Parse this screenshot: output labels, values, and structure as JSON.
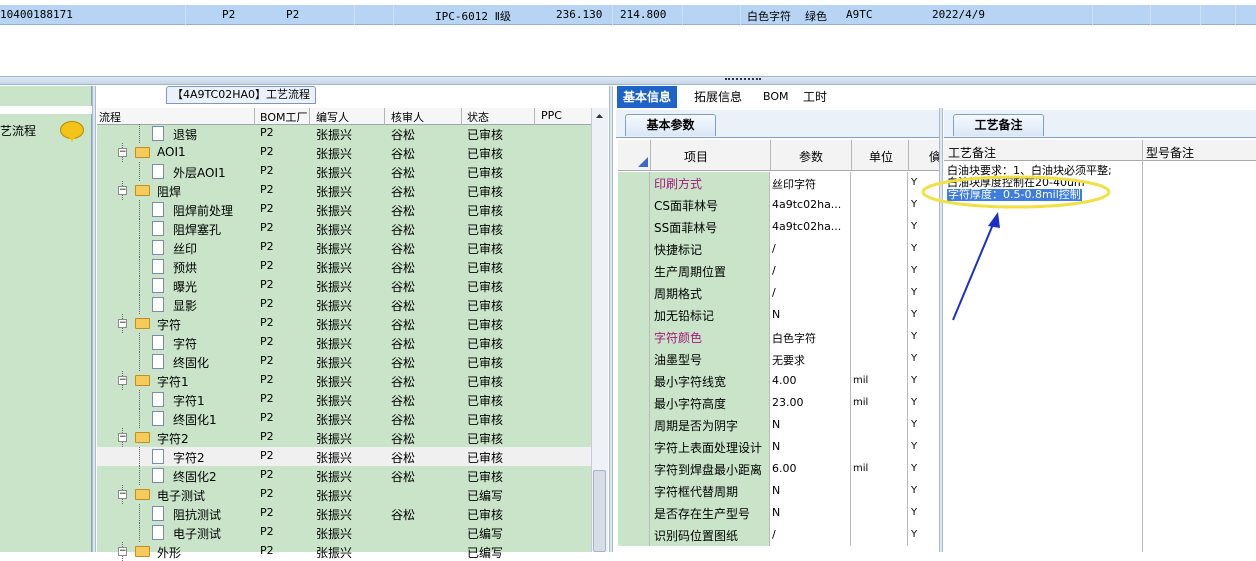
{
  "top_row": {
    "cells": [
      "10400188171",
      "P2",
      "P2",
      "IPC-6012 Ⅱ级",
      "236.130",
      "214.800",
      "白色字符",
      "绿色",
      "A9TC",
      "2022/4/9"
    ]
  },
  "left_panel": {
    "title": "艺流程"
  },
  "tree": {
    "title": "【4A9TC02HA0】工艺流程",
    "headers": [
      "流程",
      "BOM工厂",
      "编写人",
      "核审人",
      "状态",
      "PPC"
    ],
    "rows": [
      {
        "type": "item",
        "name": "退锡",
        "bom": "P2",
        "writer": "张振兴",
        "reviewer": "谷松",
        "status": "已审核"
      },
      {
        "type": "group",
        "name": "AOI1",
        "bom": "P2",
        "writer": "张振兴",
        "reviewer": "谷松",
        "status": "已审核"
      },
      {
        "type": "item",
        "name": "外层AOI1",
        "bom": "P2",
        "writer": "张振兴",
        "reviewer": "谷松",
        "status": "已审核"
      },
      {
        "type": "group",
        "name": "阻焊",
        "bom": "P2",
        "writer": "张振兴",
        "reviewer": "谷松",
        "status": "已审核"
      },
      {
        "type": "item",
        "name": "阻焊前处理",
        "bom": "P2",
        "writer": "张振兴",
        "reviewer": "谷松",
        "status": "已审核"
      },
      {
        "type": "item",
        "name": "阻焊塞孔",
        "bom": "P2",
        "writer": "张振兴",
        "reviewer": "谷松",
        "status": "已审核"
      },
      {
        "type": "item",
        "name": "丝印",
        "bom": "P2",
        "writer": "张振兴",
        "reviewer": "谷松",
        "status": "已审核"
      },
      {
        "type": "item",
        "name": "预烘",
        "bom": "P2",
        "writer": "张振兴",
        "reviewer": "谷松",
        "status": "已审核"
      },
      {
        "type": "item",
        "name": "曝光",
        "bom": "P2",
        "writer": "张振兴",
        "reviewer": "谷松",
        "status": "已审核"
      },
      {
        "type": "item",
        "name": "显影",
        "bom": "P2",
        "writer": "张振兴",
        "reviewer": "谷松",
        "status": "已审核"
      },
      {
        "type": "group",
        "name": "字符",
        "bom": "P2",
        "writer": "张振兴",
        "reviewer": "谷松",
        "status": "已审核"
      },
      {
        "type": "item",
        "name": "字符",
        "bom": "P2",
        "writer": "张振兴",
        "reviewer": "谷松",
        "status": "已审核"
      },
      {
        "type": "item",
        "name": "终固化",
        "bom": "P2",
        "writer": "张振兴",
        "reviewer": "谷松",
        "status": "已审核"
      },
      {
        "type": "group",
        "name": "字符1",
        "bom": "P2",
        "writer": "张振兴",
        "reviewer": "谷松",
        "status": "已审核"
      },
      {
        "type": "item",
        "name": "字符1",
        "bom": "P2",
        "writer": "张振兴",
        "reviewer": "谷松",
        "status": "已审核"
      },
      {
        "type": "item",
        "name": "终固化1",
        "bom": "P2",
        "writer": "张振兴",
        "reviewer": "谷松",
        "status": "已审核"
      },
      {
        "type": "group",
        "name": "字符2",
        "bom": "P2",
        "writer": "张振兴",
        "reviewer": "谷松",
        "status": "已审核"
      },
      {
        "type": "item",
        "name": "字符2",
        "bom": "P2",
        "writer": "张振兴",
        "reviewer": "谷松",
        "status": "已审核",
        "selected": true
      },
      {
        "type": "item",
        "name": "终固化2",
        "bom": "P2",
        "writer": "张振兴",
        "reviewer": "谷松",
        "status": "已审核"
      },
      {
        "type": "group",
        "name": "电子测试",
        "bom": "P2",
        "writer": "张振兴",
        "reviewer": "",
        "status": "已编写"
      },
      {
        "type": "item",
        "name": "阻抗测试",
        "bom": "P2",
        "writer": "张振兴",
        "reviewer": "谷松",
        "status": "已审核"
      },
      {
        "type": "item",
        "name": "电子测试",
        "bom": "P2",
        "writer": "张振兴",
        "reviewer": "",
        "status": "已编写"
      },
      {
        "type": "group",
        "name": "外形",
        "bom": "P2",
        "writer": "张振兴",
        "reviewer": "",
        "status": "已编写"
      }
    ]
  },
  "tabs": [
    "基本信息",
    "拓展信息",
    "BOM",
    "工时"
  ],
  "param_tab": "基本参数",
  "param_headers": [
    "项目",
    "参数",
    "单位",
    "僋"
  ],
  "params": [
    {
      "item": "印刷方式",
      "value": "丝印字符",
      "unit": "",
      "flag": "Y",
      "hl": true
    },
    {
      "item": "CS面菲林号",
      "value": "4a9tc02ha...",
      "unit": "",
      "flag": "Y"
    },
    {
      "item": "SS面菲林号",
      "value": "4a9tc02ha...",
      "unit": "",
      "flag": "Y"
    },
    {
      "item": "快捷标记",
      "value": "/",
      "unit": "",
      "flag": "Y"
    },
    {
      "item": "生产周期位置",
      "value": "/",
      "unit": "",
      "flag": "Y"
    },
    {
      "item": "周期格式",
      "value": "/",
      "unit": "",
      "flag": "Y"
    },
    {
      "item": "加无铅标记",
      "value": "N",
      "unit": "",
      "flag": "Y"
    },
    {
      "item": "字符颜色",
      "value": "白色字符",
      "unit": "",
      "flag": "Y",
      "hl": true
    },
    {
      "item": "油墨型号",
      "value": "无要求",
      "unit": "",
      "flag": "Y"
    },
    {
      "item": "最小字符线宽",
      "value": "4.00",
      "unit": "mil",
      "flag": "Y"
    },
    {
      "item": "最小字符高度",
      "value": "23.00",
      "unit": "mil",
      "flag": "Y"
    },
    {
      "item": "周期是否为阴字",
      "value": "N",
      "unit": "",
      "flag": "Y"
    },
    {
      "item": "字符上表面处理设计",
      "value": "N",
      "unit": "",
      "flag": "Y"
    },
    {
      "item": "字符到焊盘最小距离",
      "value": "6.00",
      "unit": "mil",
      "flag": "Y"
    },
    {
      "item": "字符框代替周期",
      "value": "N",
      "unit": "",
      "flag": "Y"
    },
    {
      "item": "是否存在生产型号",
      "value": "N",
      "unit": "",
      "flag": "Y"
    },
    {
      "item": "识别码位置图纸",
      "value": "/",
      "unit": "",
      "flag": "Y"
    }
  ],
  "notes_tab": "工艺备注",
  "notes_headers": [
    "工艺备注",
    "型号备注"
  ],
  "notes": [
    "白油块要求：1、白油块必须平整;",
    "白油块厚度控制在20-40um",
    "字符厚度：0.5-0.8mil控制"
  ],
  "colors": {
    "accent": "#1d63c8",
    "row_green": "#c9e4c9",
    "selection": "#b8d4f4",
    "annotation_yellow": "#f0e040",
    "arrow_blue": "#1b2fc9"
  }
}
